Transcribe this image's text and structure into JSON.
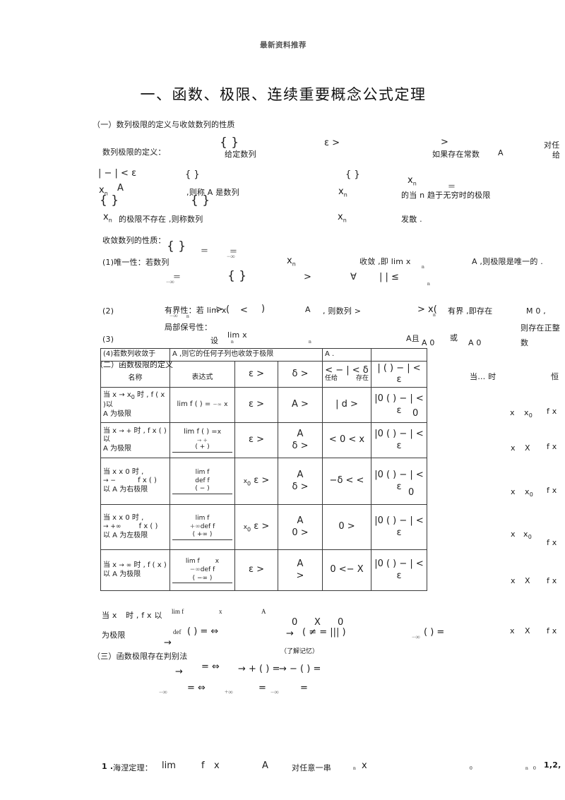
{
  "header": {
    "watermark": "最新资料推荐"
  },
  "title": "一、函数、极限、连续重要概念公式定理",
  "sections": {
    "one": "（一）数列极限的定义与收敛数列的性质",
    "two": "（二）函数极限的定义",
    "three": "（三）函数极限存在判别法"
  },
  "seq_limit": {
    "label": "数列极限的定义：",
    "given_sequence": "给定数列",
    "brace_a": "{ }",
    "eps_gt": "ε >",
    "gt": ">",
    "if_exists_const": "如果存在常数",
    "const_A": "A",
    "for_any": "对任",
    "give": "给",
    "abs_expr": "|  − | < ε",
    "brace_b": "{ }",
    "brace_c": "{ }",
    "x_n": "x",
    "n_sub": "n",
    "x_n_left": "x",
    "A_left": "A",
    "then_call": ",则称 A 是数列",
    "x_n_mid": "x",
    "of_limit": "的当 n 趋于无穷时的极限",
    "eq": "=",
    "inf": "−∞",
    "brace_d": "{ }",
    "brace_e": "{ }",
    "x_n_bot": "x",
    "no_limit": "的极限不存在 ,则称数列",
    "x_n_bot2": "x",
    "divergent": "发散 ."
  },
  "props": {
    "heading": "收敛数列的性质：",
    "p1_label": "(1)唯一性：若数列",
    "p1_brace": "{ }",
    "p1_inf": "−∞",
    "p1_eq": "=",
    "p1_xn": "x",
    "p1_conv": "收敛 ,即 lim x",
    "p1_n": "n",
    "p1_tail": "A ,则极限是唯一的 .",
    "row_inf": "−∞",
    "row_eq": "=",
    "row_brace": "{ }",
    "row_gt": ">",
    "row_forall": "∀",
    "row_bars": "|  | ≤",
    "row_n": "n",
    "p2_num": "(2)",
    "p2_label": "有界性：若 lim x",
    "p2_inf": "−∞",
    "p2_n": "n",
    "p2_gt1": "> (",
    "p2_lt": "<",
    "p2_rp": ")",
    "p2_A": "A",
    "p2_then": ", 则数列 >",
    "p2_gtx": "> x(",
    "p2_n2": "n",
    "p2_bounded": "有界 ,即存在",
    "p2_M": "M  0 ,",
    "p3_num": "(3)",
    "p3_label": "局部保号性：",
    "p3_set": "设",
    "p3_lim": "lim x",
    "p3_inf": "−∞",
    "p3_n": "n",
    "p3_n2": "n",
    "p3_A_and": "A且",
    "p3_A0a": "A  0",
    "p3_or": "或",
    "p3_A0b": "A 0",
    "p3_then": "则存在正整",
    "p3_num2": "数"
  },
  "table": {
    "row4": {
      "c0": "(4)若数列收敛于",
      "c1": "A ,则它的任何子列也收敛于极限",
      "c2": "A ."
    },
    "headers": {
      "section_label": "（二）函数极限的定义",
      "name": "名称",
      "expr": "表达式",
      "eps": "ε >",
      "delta": "δ >",
      "any_given": "任给",
      "exists": "存在",
      "cond_lt_delta": "< − | < δ",
      "cond_abs_eps": "| ( ) − | < ε",
      "when": "当… 时",
      "heng": "恒"
    },
    "rows": [
      {
        "name_top": "当 x → x",
        "name_sub": "0",
        "name_mid": "时 , f ( x )以",
        "name_bot": "A 为极限",
        "expr": "lim f (  ) =",
        "expr_sub": "−∞",
        "expr_x": "x",
        "eps": "ε >",
        "delta": "A >",
        "cond": "| d >",
        "conc": "|0 ( ) − | < ε",
        "zero": "0",
        "when_x": "x",
        "when_x0": "x",
        "when_x0sub": "0",
        "when_f": "f  x"
      },
      {
        "name_top": "当 x",
        "name_arrow": "→  +",
        "name_mid": "时 ,  f  x (  )以",
        "name_bot": "A 为极限",
        "expr": "lim f (  ) =",
        "expr_sub": "→ +",
        "expr_paren": "( + )",
        "expr_x": "x",
        "eps": "ε >",
        "delta": "A\nδ >",
        "cond": "< 0 <  x",
        "conc": "|0 ( ) − | < ε",
        "when_x": "x",
        "when_X": "X",
        "when_f": "f  x"
      },
      {
        "name_top": "当 x  x 0 时 ,",
        "name_arrow": "→  −",
        "name_fx": "f  x (  )",
        "name_bot": "以 A 为右极限",
        "expr_lim": "lim f",
        "expr_def": "def f",
        "expr_paren": "( − )",
        "expr_x0": "x",
        "expr_x0sub": "0",
        "eps": "ε >",
        "delta": "A\nδ >",
        "cond": "−δ < <",
        "conc": "|0 ( ) − | < ε",
        "zero": "0",
        "when_x": "x",
        "when_x0": "x",
        "when_x0sub": "0",
        "when_f": "f  x"
      },
      {
        "name_top": "当 x  x 0 时 ,",
        "name_arrow": "→ +∞",
        "name_fx": "f  x (  )",
        "name_bot": "以 A 为左极限",
        "expr_lim": "lim f",
        "expr_def": "def f",
        "expr_sub": "+∞",
        "expr_paren": "( +∞ )",
        "expr_x0": "x",
        "expr_x0sub": "0",
        "eps": "ε >",
        "delta": "A\n0 >",
        "cond": "0 >",
        "conc": "|0 ( ) − | < ε",
        "when_x": "x",
        "when_x0": "x",
        "when_x0sub": "0",
        "when_f": "f  x"
      },
      {
        "name_top": "当 x",
        "name_arrow": "→ ∞",
        "name_mid": "时 ,",
        "name_fx": "f ( x )",
        "name_bot": "以 A 为极限",
        "expr_lim": "lim f",
        "expr_def": "def f",
        "expr_sub": "−∞",
        "expr_paren": "( −∞ )",
        "expr_x": "x",
        "eps": "ε >",
        "delta": "A\n>",
        "cond": "0 <−   X",
        "conc": "|0 ( ) − | < ε",
        "when_x": "x",
        "when_X": "X",
        "when_f": "f  x"
      }
    ]
  },
  "tail": {
    "r_when_x": "当 x",
    "r_time": "时 ,  f  x 以",
    "r_limit": "为极限",
    "r_lim": "lim f",
    "r_def": "def",
    "r_x": "x",
    "r_A": "A",
    "r_expr": "(  ) =  ⇔",
    "r_arrow": "→",
    "r_arrow2": "→",
    "r_zero1": "0",
    "r_X": "X",
    "r_zero2": "0",
    "r_paren": "(  ≠  =  ||| )",
    "r_inf": "−∞",
    "r_eq": "( ) =",
    "r_when_x2": "x",
    "r_X2": "X",
    "r_fx": "f  x",
    "judge_note": "（了解记忆）",
    "judge_line1_arrow": "→",
    "judge_line1": "=  ⇔",
    "judge_plus": "→ + ( ) =",
    "judge_minus": "→ − ( ) =",
    "judge_line2_inf": "−∞",
    "judge_line2_eq": "=  ⇔",
    "judge_line2_inf2": "+∞",
    "judge_line2_eq2": "=",
    "judge_line2_inf3": "−∞",
    "judge_line2_eq3": "="
  },
  "footer": {
    "item_no": "1 .",
    "theorem": "海涅定理：",
    "lim": "lim",
    "f": "f",
    "x": "x",
    "A": "A",
    "for_any": "对任意一串",
    "n": "n",
    "x2": "x",
    "zero": "0",
    "n2": "n",
    "zero2": "0",
    "series": "1,2,"
  }
}
